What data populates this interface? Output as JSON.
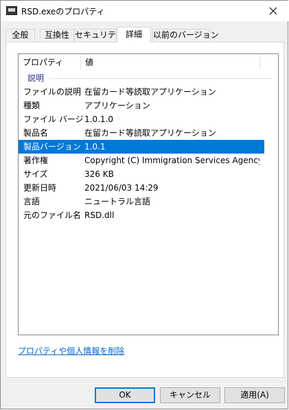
{
  "window": {
    "title": "RSD.exeのプロパティ",
    "close_icon": "close-icon"
  },
  "tabs": [
    {
      "label": "全般",
      "active": false
    },
    {
      "label": "互換性",
      "active": false
    },
    {
      "label": "セキュリティ",
      "active": false
    },
    {
      "label": "詳細",
      "active": true
    },
    {
      "label": "以前のバージョン",
      "active": false
    }
  ],
  "list": {
    "columns": {
      "property": "プロパティ",
      "value": "値"
    },
    "group": "説明",
    "rows": [
      {
        "property": "ファイルの説明",
        "value": "在留カード等読取アプリケーション",
        "selected": false
      },
      {
        "property": "種類",
        "value": "アプリケーション",
        "selected": false
      },
      {
        "property": "ファイル バージョン",
        "value": "1.0.1.0",
        "selected": false
      },
      {
        "property": "製品名",
        "value": "在留カード等読取アプリケーション",
        "selected": false
      },
      {
        "property": "製品バージョン",
        "value": "1.0.1",
        "selected": true
      },
      {
        "property": "著作権",
        "value": "Copyright (C) Immigration Services Agency of...",
        "selected": false
      },
      {
        "property": "サイズ",
        "value": "326 KB",
        "selected": false
      },
      {
        "property": "更新日時",
        "value": "2021/06/03 14:29",
        "selected": false
      },
      {
        "property": "言語",
        "value": "ニュートラル言語",
        "selected": false
      },
      {
        "property": "元のファイル名",
        "value": "RSD.dll",
        "selected": false
      }
    ],
    "selection_color": "#0078d7"
  },
  "remove_link": "プロパティや個人情報を削除",
  "buttons": {
    "ok": "OK",
    "cancel": "キャンセル",
    "apply": "適用(A)"
  }
}
